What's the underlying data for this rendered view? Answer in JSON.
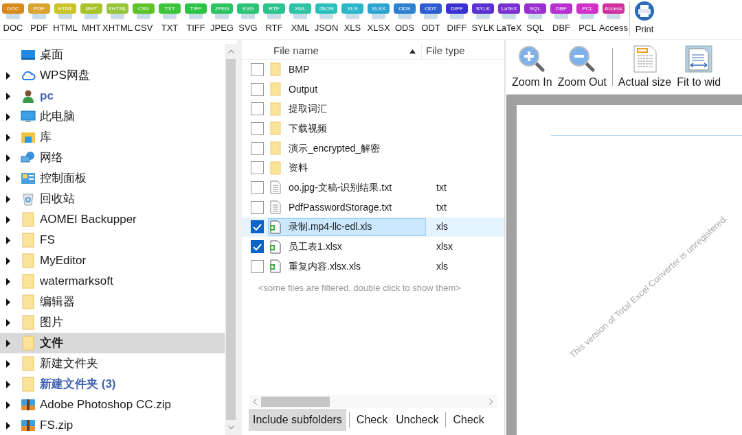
{
  "toolbar": {
    "formats": [
      {
        "badge": "DOC",
        "label": "DOC",
        "color": "#d98a1c"
      },
      {
        "badge": "PDF",
        "label": "PDF",
        "color": "#d9a530"
      },
      {
        "badge": "HTML",
        "label": "HTML",
        "color": "#c8c42a"
      },
      {
        "badge": "MHT",
        "label": "MHT",
        "color": "#a8c42a"
      },
      {
        "badge": "XHTML",
        "label": "XHTML",
        "color": "#96c43a"
      },
      {
        "badge": "CSV",
        "label": "CSV",
        "color": "#5cc42a"
      },
      {
        "badge": "TXT",
        "label": "TXT",
        "color": "#3cc43a"
      },
      {
        "badge": "TIFF",
        "label": "TIFF",
        "color": "#2cc444"
      },
      {
        "badge": "JPEG",
        "label": "JPEG",
        "color": "#2cc460"
      },
      {
        "badge": "SVG",
        "label": "SVG",
        "color": "#2cc474"
      },
      {
        "badge": "RTF",
        "label": "RTF",
        "color": "#2cc48c"
      },
      {
        "badge": "XML",
        "label": "XML",
        "color": "#2cc4a4"
      },
      {
        "badge": "JSON",
        "label": "JSON",
        "color": "#2cc0bc"
      },
      {
        "badge": "XLS",
        "label": "XLS",
        "color": "#2cb6c8"
      },
      {
        "badge": "XLSX",
        "label": "XLSX",
        "color": "#2ca4d0"
      },
      {
        "badge": "ODS",
        "label": "ODS",
        "color": "#2c80d0"
      },
      {
        "badge": "ODT",
        "label": "ODT",
        "color": "#2c5ed0"
      },
      {
        "badge": "DIFF",
        "label": "DIFF",
        "color": "#3a30d0"
      },
      {
        "badge": "SYLK",
        "label": "SYLK",
        "color": "#5a30d0"
      },
      {
        "badge": "LaTeX",
        "label": "LaTeX",
        "color": "#7a30d0"
      },
      {
        "badge": "SQL",
        "label": "SQL",
        "color": "#9a30d0"
      },
      {
        "badge": "DBF",
        "label": "DBF",
        "color": "#b830d0"
      },
      {
        "badge": "PCL",
        "label": "PCL",
        "color": "#d030c8"
      },
      {
        "badge": "Access",
        "label": "Access",
        "color": "#d030a0"
      }
    ],
    "print": {
      "label": "Print"
    }
  },
  "tree": [
    {
      "kind": "desktop",
      "label": "桌面",
      "expandable": false,
      "selected": false,
      "bold": false,
      "blue": false
    },
    {
      "kind": "cloud",
      "label": "WPS网盘",
      "expandable": true,
      "selected": false,
      "bold": false,
      "blue": false
    },
    {
      "kind": "user",
      "label": "pc",
      "expandable": true,
      "selected": false,
      "bold": true,
      "blue": true
    },
    {
      "kind": "computer",
      "label": "此电脑",
      "expandable": true,
      "selected": false,
      "bold": false,
      "blue": false
    },
    {
      "kind": "library",
      "label": "库",
      "expandable": true,
      "selected": false,
      "bold": false,
      "blue": false
    },
    {
      "kind": "network",
      "label": "网络",
      "expandable": true,
      "selected": false,
      "bold": false,
      "blue": false
    },
    {
      "kind": "control",
      "label": "控制面板",
      "expandable": true,
      "selected": false,
      "bold": false,
      "blue": false
    },
    {
      "kind": "recycle",
      "label": "回收站",
      "expandable": true,
      "selected": false,
      "bold": false,
      "blue": false
    },
    {
      "kind": "folder",
      "label": "AOMEI Backupper",
      "expandable": true,
      "selected": false,
      "bold": false,
      "blue": false
    },
    {
      "kind": "folder",
      "label": "FS",
      "expandable": true,
      "selected": false,
      "bold": false,
      "blue": false
    },
    {
      "kind": "folder",
      "label": "MyEditor",
      "expandable": true,
      "selected": false,
      "bold": false,
      "blue": false
    },
    {
      "kind": "folder",
      "label": "watermarksoft",
      "expandable": true,
      "selected": false,
      "bold": false,
      "blue": false
    },
    {
      "kind": "folder",
      "label": "编辑器",
      "expandable": true,
      "selected": false,
      "bold": false,
      "blue": false
    },
    {
      "kind": "folder",
      "label": "图片",
      "expandable": true,
      "selected": false,
      "bold": false,
      "blue": false
    },
    {
      "kind": "folder",
      "label": "文件",
      "expandable": true,
      "selected": true,
      "bold": true,
      "blue": false
    },
    {
      "kind": "folder",
      "label": "新建文件夹",
      "expandable": true,
      "selected": false,
      "bold": false,
      "blue": false
    },
    {
      "kind": "folder",
      "label": "新建文件夹 (3)",
      "expandable": true,
      "selected": false,
      "bold": true,
      "blue": true
    },
    {
      "kind": "zip",
      "label": "Adobe Photoshop CC.zip",
      "expandable": true,
      "selected": false,
      "bold": false,
      "blue": false
    },
    {
      "kind": "zip",
      "label": "FS.zip",
      "expandable": true,
      "selected": false,
      "bold": false,
      "blue": false
    }
  ],
  "file_list": {
    "columns": [
      "File name",
      "File type"
    ],
    "rows": [
      {
        "kind": "folder",
        "name": "BMP",
        "type": "",
        "checked": false,
        "selected": false
      },
      {
        "kind": "folder",
        "name": "Output",
        "type": "",
        "checked": false,
        "selected": false
      },
      {
        "kind": "folder",
        "name": "提取词汇",
        "type": "",
        "checked": false,
        "selected": false
      },
      {
        "kind": "folder",
        "name": "下载视频",
        "type": "",
        "checked": false,
        "selected": false
      },
      {
        "kind": "folder",
        "name": "演示_encrypted_解密",
        "type": "",
        "checked": false,
        "selected": false
      },
      {
        "kind": "folder",
        "name": "资料",
        "type": "",
        "checked": false,
        "selected": false
      },
      {
        "kind": "text",
        "name": "oo.jpg-文稿-识别结果.txt",
        "type": "txt",
        "checked": false,
        "selected": false
      },
      {
        "kind": "text",
        "name": "PdfPasswordStorage.txt",
        "type": "txt",
        "checked": false,
        "selected": false
      },
      {
        "kind": "sheet",
        "name": "录制.mp4-llc-edl.xls",
        "type": "xls",
        "checked": true,
        "selected": true
      },
      {
        "kind": "sheet",
        "name": "员工表1.xlsx",
        "type": "xlsx",
        "checked": true,
        "selected": false
      },
      {
        "kind": "sheet",
        "name": "重复内容.xlsx.xls",
        "type": "xls",
        "checked": false,
        "selected": false
      }
    ],
    "note": "<some files are filtered, double click to show them>"
  },
  "bottom_buttons": [
    {
      "label": "Include subfolders",
      "pressed": true
    },
    {
      "label": "Check",
      "pressed": false
    },
    {
      "label": "Uncheck",
      "pressed": false
    },
    {
      "label": "Check",
      "pressed": false
    }
  ],
  "preview": {
    "tools": [
      {
        "kind": "zoom-in",
        "label": "Zoom In"
      },
      {
        "kind": "zoom-out",
        "label": "Zoom Out"
      },
      {
        "kind": "actual",
        "label": "Actual size"
      },
      {
        "kind": "fit",
        "label": "Fit to wid"
      }
    ],
    "page_watermark": "This version of Total Excel Converter is unregistered."
  }
}
